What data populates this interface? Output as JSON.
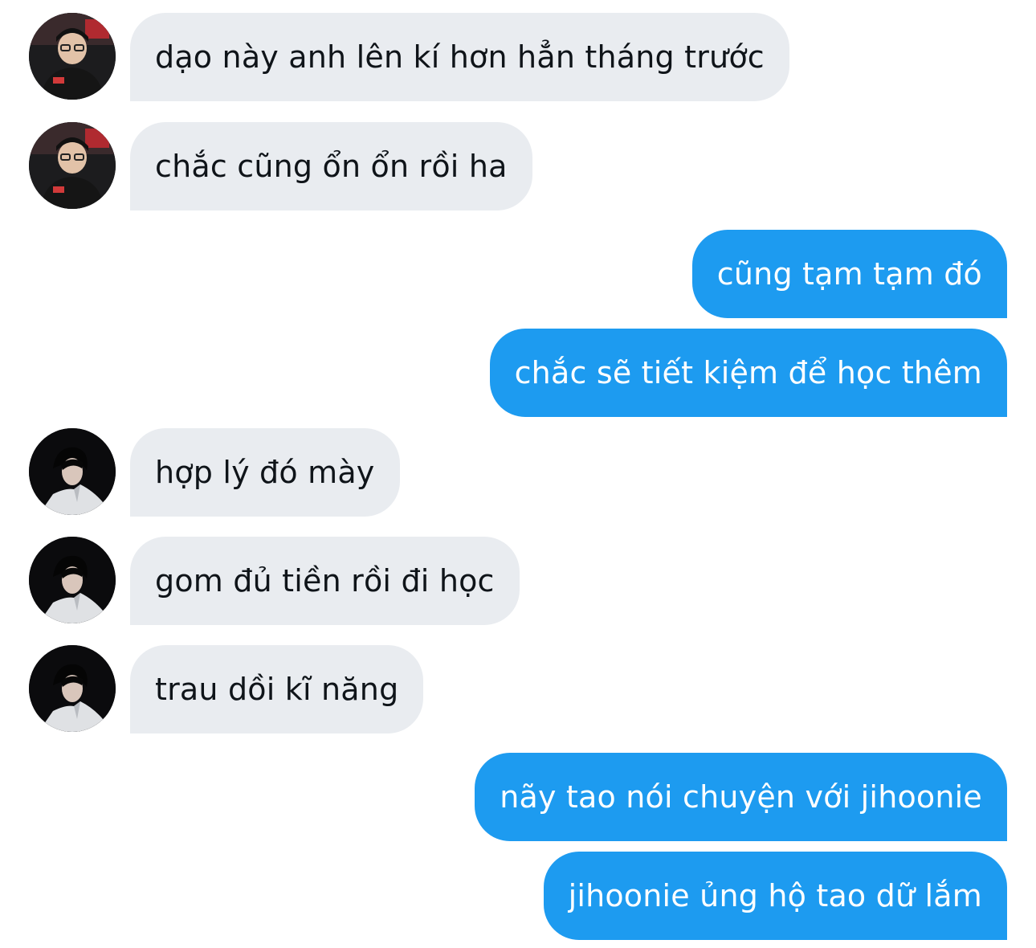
{
  "conversation": {
    "messages": [
      {
        "from": "contact_a",
        "text": "dạo này anh lên kí hơn hẳn tháng trước"
      },
      {
        "from": "contact_a",
        "text": "chắc cũng ổn ổn rồi ha"
      },
      {
        "from": "me",
        "text": "cũng tạm tạm đó"
      },
      {
        "from": "me",
        "text": "chắc sẽ tiết kiệm để học thêm"
      },
      {
        "from": "contact_b",
        "text": "hợp lý đó mày"
      },
      {
        "from": "contact_b",
        "text": "gom đủ tiền rồi đi học"
      },
      {
        "from": "contact_b",
        "text": "trau dồi kĩ năng"
      },
      {
        "from": "me",
        "text": "nãy tao nói chuyện với jihoonie"
      },
      {
        "from": "me",
        "text": "jihoonie ủng hộ tao dữ lắm"
      }
    ]
  },
  "colors": {
    "incoming_bubble": "#e9ecf0",
    "incoming_text": "#0f1419",
    "outgoing_bubble": "#1d9bf0",
    "outgoing_text": "#ffffff"
  }
}
